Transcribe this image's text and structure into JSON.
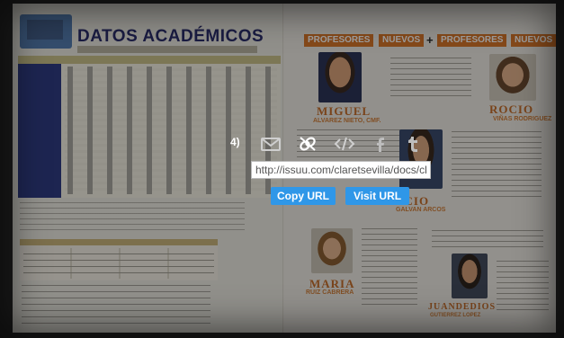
{
  "document": {
    "left_page": {
      "title": "DATOS ACADÉMICOS"
    },
    "right_page": {
      "banner_words": [
        "PROFESORES",
        "NUEVOS",
        "+",
        "PROFESORES",
        "NUEVOS"
      ],
      "teachers": [
        {
          "first": "MIGUEL",
          "last": "ALVAREZ NIETO, CMF."
        },
        {
          "first": "ROCIO",
          "last": "VIÑAS RODRIGUEZ"
        },
        {
          "first": "ROCIO",
          "last": "GALVAN ARCOS"
        },
        {
          "first": "MARIA",
          "last": "RUIZ CABRERA"
        },
        {
          "first": "JUANDEDIOS",
          "last": "GUTIERREZ LOPEZ"
        }
      ]
    }
  },
  "share_overlay": {
    "step_label": "4)",
    "icons": [
      "email-icon",
      "link-icon",
      "embed-icon",
      "facebook-icon",
      "tumblr-icon"
    ],
    "url_value": "http://issuu.com/claretsevilla/docs/cla",
    "copy_button": "Copy URL",
    "visit_button": "Visit URL"
  },
  "colors": {
    "accent_button": "#2f97e8",
    "banner_orange": "#d7772a",
    "table_blue": "#2f3d84"
  }
}
